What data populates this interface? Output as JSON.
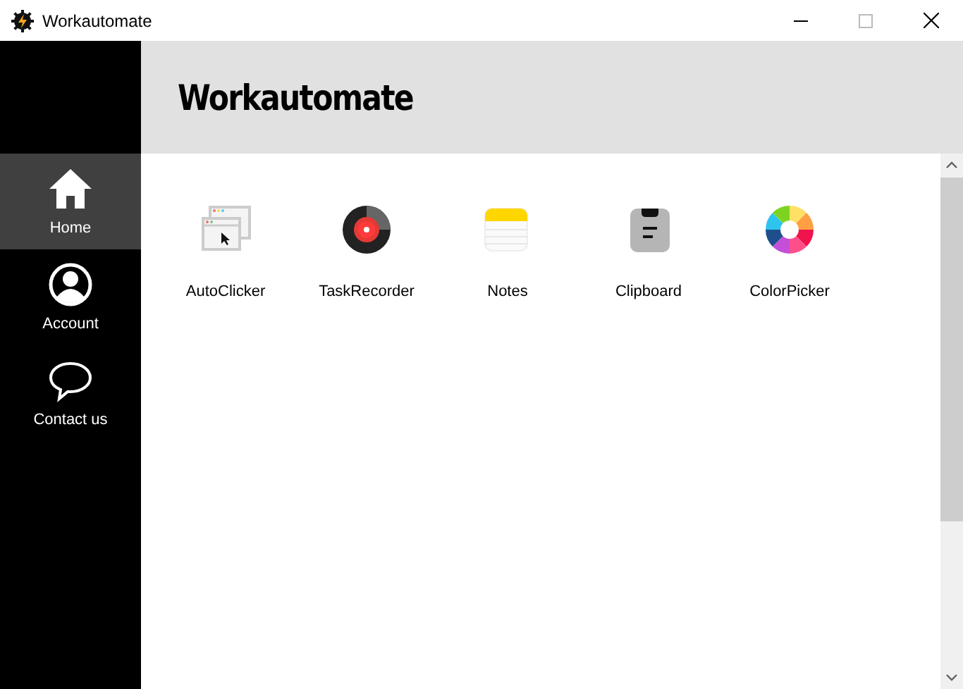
{
  "window": {
    "title": "Workautomate"
  },
  "header": {
    "title": "Workautomate"
  },
  "sidebar": {
    "items": [
      {
        "kind": "home",
        "label": "Home",
        "selected": true
      },
      {
        "kind": "account",
        "label": "Account",
        "selected": false
      },
      {
        "kind": "chat",
        "label": "Contact us",
        "selected": false
      }
    ]
  },
  "apps": [
    {
      "kind": "clicker",
      "label": "AutoClicker"
    },
    {
      "kind": "recorder",
      "label": "TaskRecorder"
    },
    {
      "kind": "notes",
      "label": "Notes"
    },
    {
      "kind": "clipboard",
      "label": "Clipboard"
    },
    {
      "kind": "colors",
      "label": "ColorPicker"
    }
  ]
}
